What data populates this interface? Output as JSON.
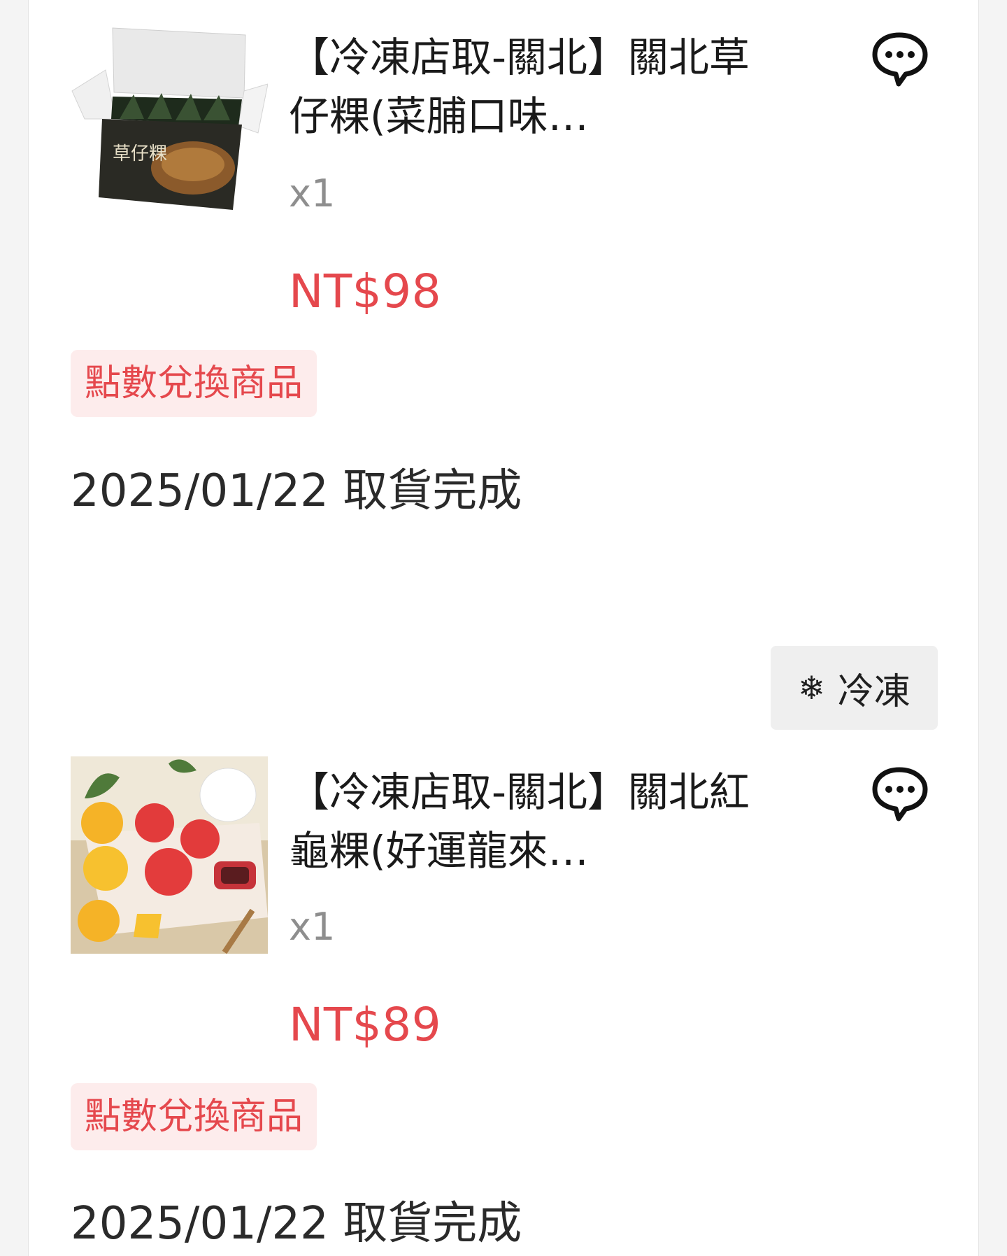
{
  "orders": [
    {
      "title": "【冷凍店取-關北】關北草仔粿(菜脯口味…",
      "quantity": "x1",
      "price": "NT$98",
      "badge": "點數兌換商品",
      "status": "2025/01/22 取貨完成",
      "image_icon": "product-image-caozaiguo-box"
    },
    {
      "title": "【冷凍店取-關北】關北紅龜粿(好運龍來…",
      "quantity": "x1",
      "price": "NT$89",
      "badge": "點數兌換商品",
      "status": "2025/01/22 取貨完成",
      "image_icon": "product-image-red-turtle-cake"
    }
  ],
  "frozen_tag": {
    "icon": "snowflake-icon",
    "glyph": "❄",
    "label": "冷凍"
  },
  "colors": {
    "price": "#e5484d",
    "badge_bg": "#fdecec",
    "quantity": "#8e8e8e"
  }
}
